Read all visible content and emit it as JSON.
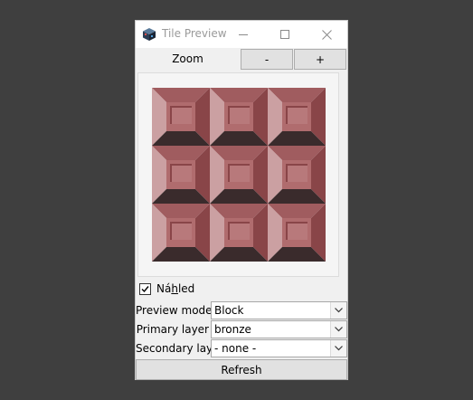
{
  "window": {
    "title": "Tile Preview",
    "controls": {
      "minimize": "minimize-icon",
      "maximize": "maximize-icon",
      "close": "close-icon"
    }
  },
  "zoom": {
    "label": "Zoom",
    "minus_label": "-",
    "plus_label": "+"
  },
  "preview": {
    "grid_cols": 3,
    "grid_rows": 3,
    "colors": {
      "face": "#b06c6e",
      "light": "#cba0a2",
      "mid": "#a05c5f",
      "dark_side": "#894548",
      "bottom": "#3a2b2c",
      "inner": "#b8797b"
    }
  },
  "nahled": {
    "label_before": "Ná",
    "label_mnemonic": "h",
    "label_after": "led",
    "checked": true
  },
  "fields": {
    "preview_mode": {
      "label": "Preview mode",
      "value": "Block"
    },
    "primary_layer": {
      "label": "Primary layer",
      "value": "bronze"
    },
    "secondary_layer": {
      "label": "Secondary layer",
      "value": "- none -"
    }
  },
  "refresh_label": "Refresh"
}
